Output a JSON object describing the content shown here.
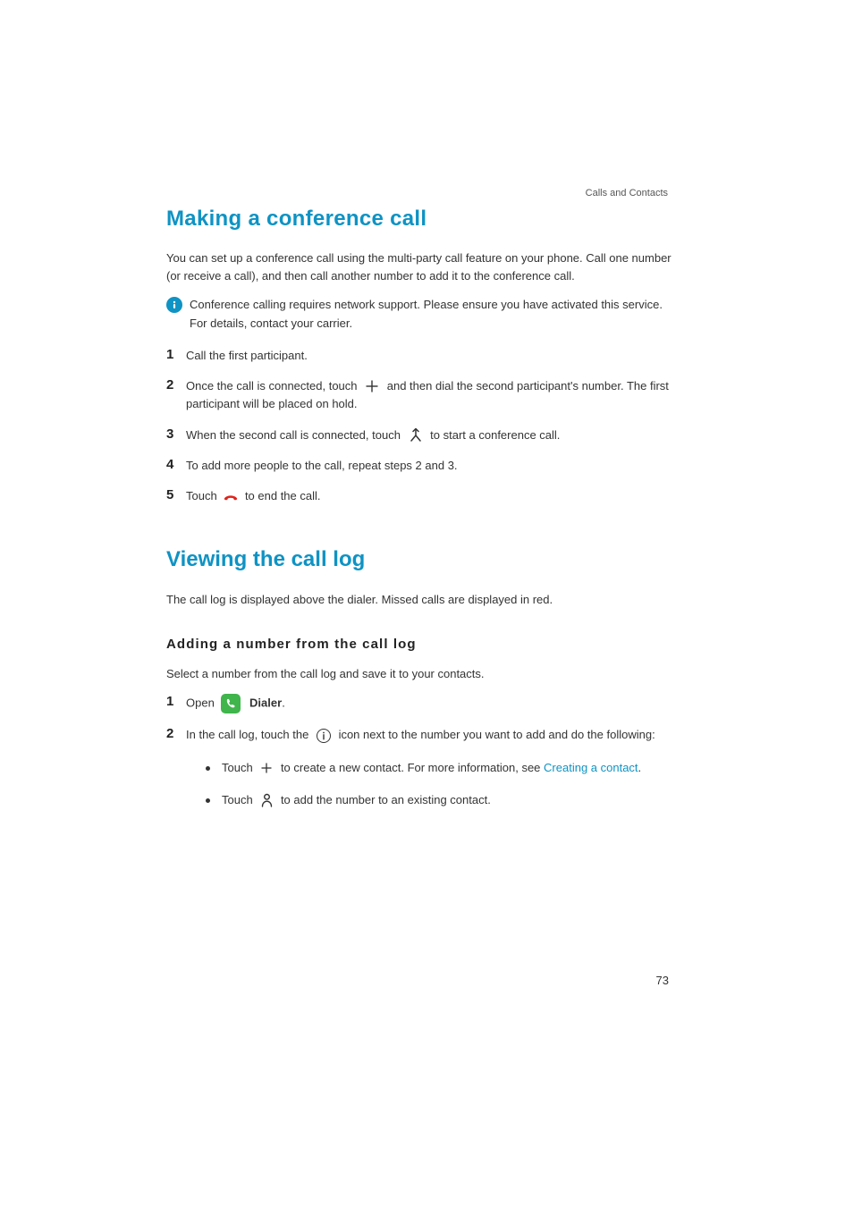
{
  "header": {
    "section_label": "Calls and Contacts"
  },
  "section1": {
    "title": "Making a conference call",
    "intro": "You can set up a conference call using the multi-party call feature on your phone. Call one number (or receive a call), and then call another number to add it to the conference call.",
    "info_note": "Conference calling requires network support. Please ensure you have activated this service. For details, contact your carrier.",
    "steps": {
      "s1": "Call the first participant.",
      "s2_a": "Once the call is connected, touch ",
      "s2_b": " and then dial the second participant's number. The first participant will be placed on hold.",
      "s3_a": "When the second call is connected, touch ",
      "s3_b": " to start a conference call.",
      "s4": "To add more people to the call, repeat steps 2 and 3.",
      "s5_a": "Touch ",
      "s5_b": " to end the call."
    }
  },
  "section2": {
    "title": "Viewing the call log",
    "intro": "The call log is displayed above the dialer. Missed calls are displayed in red.",
    "subheading": "Adding a number from the call log",
    "subintro": "Select a number from the call log and save it to your contacts.",
    "steps": {
      "s1_a": "Open ",
      "s1_app": "Dialer",
      "s1_b": ".",
      "s2_a": "In the call log, touch the ",
      "s2_b": " icon next to the number you want to add and do the following:"
    },
    "bullets": {
      "b1_a": "Touch ",
      "b1_b": " to create a new contact. For more information, see ",
      "b1_link": "Creating a contact",
      "b1_c": ".",
      "b2_a": "Touch ",
      "b2_b": " to add the number to an existing contact."
    }
  },
  "page_number": "73"
}
